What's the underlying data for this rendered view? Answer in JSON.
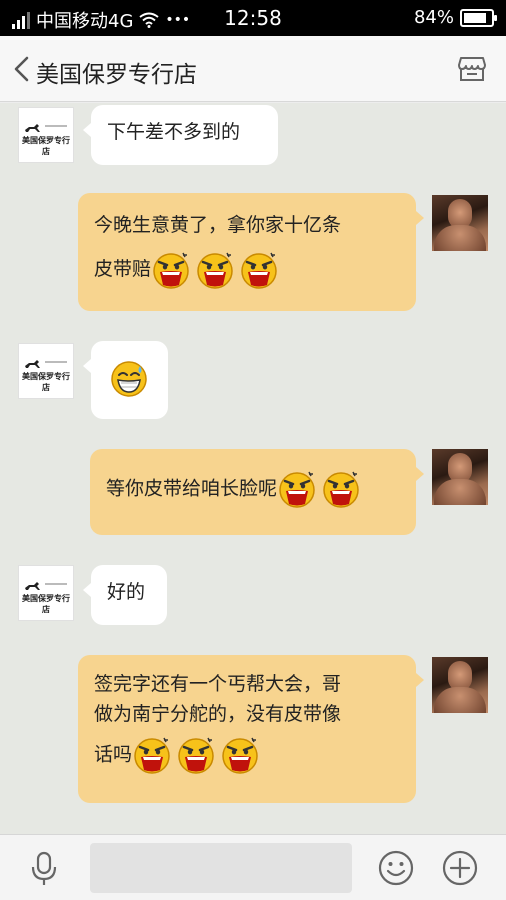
{
  "status": {
    "carrier": "中国移动4G",
    "more": "•••",
    "time": "12:58",
    "battery_text": "84%",
    "battery_level": 0.84
  },
  "header": {
    "title": "美国保罗专行店",
    "back_icon": "chevron-left-icon",
    "store_icon": "store-icon"
  },
  "shop_avatar": {
    "brand": "美国保罗专行店"
  },
  "messages": [
    {
      "from": "shop",
      "text": "下午差不多到的"
    },
    {
      "from": "me",
      "line1": "今晚生意黄了，拿你家十亿条",
      "line2": "皮带赔",
      "emoji": "shouting-emoji",
      "emoji_count": 3
    },
    {
      "from": "shop",
      "emoji": "sweat-smile-emoji"
    },
    {
      "from": "me",
      "text": "等你皮带给咱长脸呢",
      "emoji": "shouting-emoji",
      "emoji_count": 2
    },
    {
      "from": "shop",
      "text": "好的"
    },
    {
      "from": "me",
      "line1": "签完字还有一个丐帮大会，哥",
      "line2": "做为南宁分舵的，没有皮带像",
      "line3": "话吗",
      "emoji": "shouting-emoji",
      "emoji_count": 3
    }
  ],
  "toolbar": {
    "voice_icon": "microphone-icon",
    "emoji_icon": "smiley-icon",
    "more_icon": "plus-circle-icon"
  },
  "colors": {
    "outgoing_bubble": "#f7d48f",
    "incoming_bubble": "#ffffff",
    "chat_background": "#e6e8e3"
  }
}
